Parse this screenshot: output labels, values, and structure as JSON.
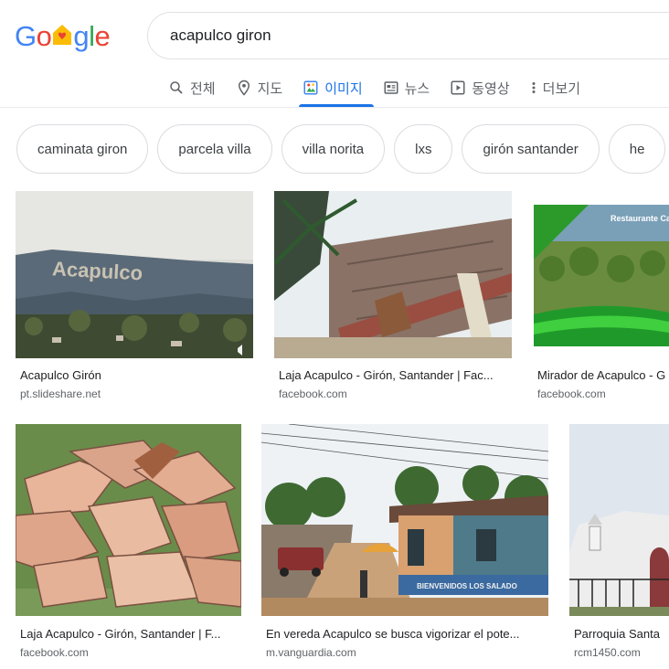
{
  "logo": {
    "text": "Google"
  },
  "search": {
    "query": "acapulco giron"
  },
  "tabs": [
    {
      "label": "전체",
      "icon": "search-icon",
      "active": false
    },
    {
      "label": "지도",
      "icon": "map-pin-icon",
      "active": false
    },
    {
      "label": "이미지",
      "icon": "image-icon",
      "active": true
    },
    {
      "label": "뉴스",
      "icon": "news-icon",
      "active": false
    },
    {
      "label": "동영상",
      "icon": "video-icon",
      "active": false
    },
    {
      "label": "더보기",
      "icon": "more-vert-icon",
      "active": false
    }
  ],
  "chips": [
    "caminata giron",
    "parcela villa",
    "villa norita",
    "lxs",
    "girón santander",
    "he"
  ],
  "results": [
    {
      "title": "Acapulco Girón",
      "source": "pt.slideshare.net",
      "thumb_text": "Acapulco"
    },
    {
      "title": "Laja Acapulco - Girón, Santander | Fac...",
      "source": "facebook.com"
    },
    {
      "title": "Mirador de Acapulco - G",
      "source": "facebook.com",
      "thumb_text": "Restaurante Camping -"
    },
    {
      "title": "Laja Acapulco - Girón, Santander | F...",
      "source": "facebook.com"
    },
    {
      "title": "En vereda Acapulco se busca vigorizar el pote...",
      "source": "m.vanguardia.com",
      "thumb_text": "BIENVENIDOS LOS SALADO"
    },
    {
      "title": "Parroquia Santa",
      "source": "rcm1450.com"
    }
  ],
  "colors": {
    "accent": "#1a73e8",
    "blue": "#4285f4",
    "red": "#ea4335",
    "yellow": "#fbbc05",
    "green": "#34a853"
  }
}
